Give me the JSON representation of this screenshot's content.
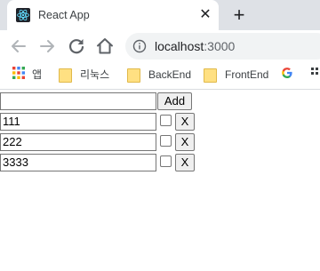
{
  "browser": {
    "tab": {
      "title": "React App",
      "favicon": "react-icon",
      "close_glyph": "✕"
    },
    "new_tab_glyph": "+",
    "url": {
      "host": "localhost",
      "port": ":3000"
    },
    "bookmarks": [
      {
        "label": "앱",
        "icon": "apps-grid-icon"
      },
      {
        "label": "리눅스",
        "icon": "folder-icon"
      },
      {
        "label": "BackEnd",
        "icon": "folder-icon"
      },
      {
        "label": "FrontEnd",
        "icon": "folder-icon"
      },
      {
        "label": "",
        "icon": "google-icon"
      }
    ],
    "colors": {
      "tab_strip": "#dee1e6",
      "omnibox": "#f1f3f4",
      "folder": "#ffe082"
    }
  },
  "app": {
    "new_item_input": {
      "value": "",
      "placeholder": ""
    },
    "add_button_label": "Add",
    "items": [
      {
        "text": "111",
        "checked": false,
        "delete_label": "X"
      },
      {
        "text": "222",
        "checked": false,
        "delete_label": "X"
      },
      {
        "text": "3333",
        "checked": false,
        "delete_label": "X"
      }
    ]
  }
}
